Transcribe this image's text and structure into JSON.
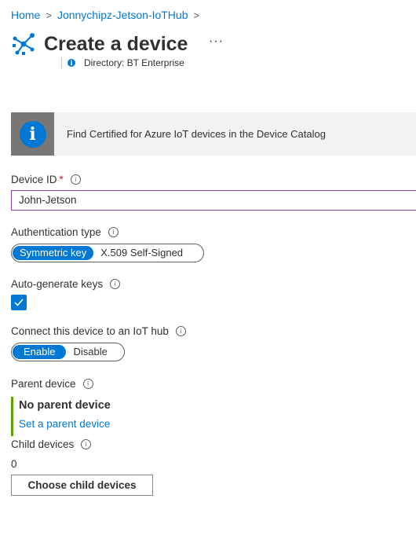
{
  "breadcrumb": {
    "home": "Home",
    "hub": "Jonnychipz-Jetson-IoTHub",
    "sep": ">"
  },
  "header": {
    "title": "Create a device",
    "more": "···",
    "directory": "Directory: BT Enterprise",
    "icon": "iot-device-icon"
  },
  "banner": {
    "text": "Find Certified for Azure IoT devices in the Device Catalog",
    "icon": "info-icon"
  },
  "device_id": {
    "label": "Device ID",
    "required": "*",
    "value": "John-Jetson"
  },
  "auth": {
    "label": "Authentication type",
    "options": [
      "Symmetric key",
      "X.509 Self-Signed"
    ],
    "selected": "Symmetric key"
  },
  "autogen": {
    "label": "Auto-generate keys",
    "checked": true
  },
  "connect": {
    "label": "Connect this device to an IoT hub",
    "options": [
      "Enable",
      "Disable"
    ],
    "selected": "Enable"
  },
  "parent": {
    "label": "Parent device",
    "value": "No parent device",
    "link": "Set a parent device"
  },
  "child": {
    "label": "Child devices",
    "count": "0",
    "button": "Choose child devices"
  },
  "colors": {
    "accent": "#0078d4",
    "link": "#0078d4",
    "required": "#a4262c",
    "parent_bar": "#57a300"
  }
}
